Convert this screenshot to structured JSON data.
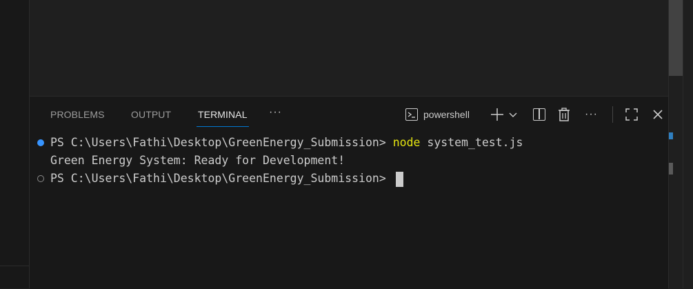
{
  "panel": {
    "tabs": [
      {
        "label": "PROBLEMS",
        "active": false
      },
      {
        "label": "OUTPUT",
        "active": false
      },
      {
        "label": "TERMINAL",
        "active": true
      }
    ],
    "more_tabs": "···",
    "toolbar": {
      "terminal_name": "powershell",
      "icons": [
        "terminal-icon",
        "plus-icon",
        "chevron-down-icon",
        "split-terminal-icon",
        "trash-icon",
        "more-actions-icon",
        "maximize-panel-icon",
        "close-icon"
      ],
      "more_label": "···",
      "close_label": "✕"
    }
  },
  "terminal": {
    "lines": [
      {
        "prompt": "PS C:\\Users\\Fathi\\Desktop\\GreenEnergy_Submission> ",
        "command_keyword": "node",
        "command_args": " system_test.js",
        "marker": "success"
      },
      {
        "output": "Green Energy System: Ready for Development!"
      },
      {
        "prompt": "PS C:\\Users\\Fathi\\Desktop\\GreenEnergy_Submission> ",
        "marker": "empty"
      }
    ]
  },
  "colors": {
    "accent": "#0078d4",
    "keyword": "#e5e510",
    "panel_bg": "#181818",
    "editor_bg": "#1f1f1f"
  }
}
